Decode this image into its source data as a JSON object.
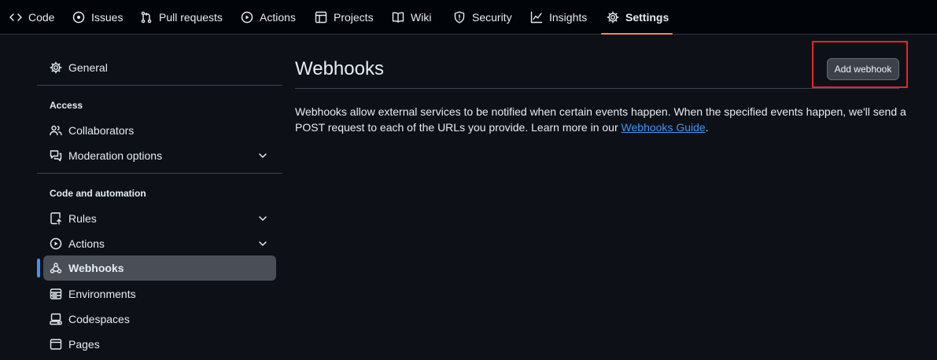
{
  "repo_nav": {
    "tabs": [
      {
        "label": "Code",
        "icon": "code-icon"
      },
      {
        "label": "Issues",
        "icon": "issue-opened-icon"
      },
      {
        "label": "Pull requests",
        "icon": "git-pull-request-icon"
      },
      {
        "label": "Actions",
        "icon": "play-icon"
      },
      {
        "label": "Projects",
        "icon": "table-icon"
      },
      {
        "label": "Wiki",
        "icon": "book-icon"
      },
      {
        "label": "Security",
        "icon": "shield-icon"
      },
      {
        "label": "Insights",
        "icon": "graph-icon"
      },
      {
        "label": "Settings",
        "icon": "gear-icon",
        "active": true
      }
    ]
  },
  "sidebar": {
    "general": "General",
    "access_heading": "Access",
    "collaborators": "Collaborators",
    "moderation": "Moderation options",
    "code_automation_heading": "Code and automation",
    "rules": "Rules",
    "actions": "Actions",
    "webhooks": "Webhooks",
    "environments": "Environments",
    "codespaces": "Codespaces",
    "pages": "Pages"
  },
  "main": {
    "title": "Webhooks",
    "add_button": "Add webhook",
    "description": "Webhooks allow external services to be notified when certain events happen. When the specified events happen, we'll send a POST request to each of the URLs you provide. Learn more in our ",
    "guide_link": "Webhooks Guide",
    "description_end": "."
  },
  "colors": {
    "background": "#0d1117",
    "header_bg": "#010409",
    "accent_underline": "#f78166",
    "link": "#4493f8",
    "selected_item": "#4a4e56",
    "highlight_box": "#e5252b"
  }
}
